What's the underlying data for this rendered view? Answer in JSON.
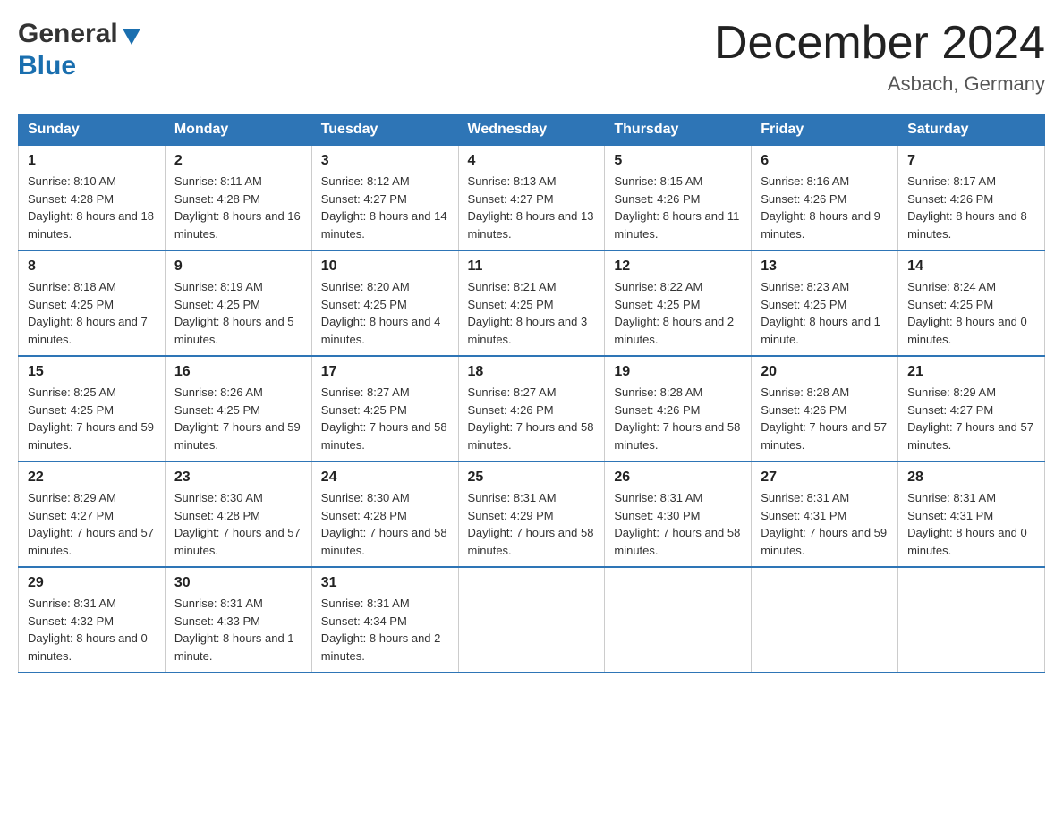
{
  "header": {
    "logo_general": "General",
    "logo_blue": "Blue",
    "calendar_title": "December 2024",
    "calendar_subtitle": "Asbach, Germany"
  },
  "columns": [
    "Sunday",
    "Monday",
    "Tuesday",
    "Wednesday",
    "Thursday",
    "Friday",
    "Saturday"
  ],
  "weeks": [
    [
      {
        "day": "1",
        "sunrise": "8:10 AM",
        "sunset": "4:28 PM",
        "daylight": "8 hours and 18 minutes."
      },
      {
        "day": "2",
        "sunrise": "8:11 AM",
        "sunset": "4:28 PM",
        "daylight": "8 hours and 16 minutes."
      },
      {
        "day": "3",
        "sunrise": "8:12 AM",
        "sunset": "4:27 PM",
        "daylight": "8 hours and 14 minutes."
      },
      {
        "day": "4",
        "sunrise": "8:13 AM",
        "sunset": "4:27 PM",
        "daylight": "8 hours and 13 minutes."
      },
      {
        "day": "5",
        "sunrise": "8:15 AM",
        "sunset": "4:26 PM",
        "daylight": "8 hours and 11 minutes."
      },
      {
        "day": "6",
        "sunrise": "8:16 AM",
        "sunset": "4:26 PM",
        "daylight": "8 hours and 9 minutes."
      },
      {
        "day": "7",
        "sunrise": "8:17 AM",
        "sunset": "4:26 PM",
        "daylight": "8 hours and 8 minutes."
      }
    ],
    [
      {
        "day": "8",
        "sunrise": "8:18 AM",
        "sunset": "4:25 PM",
        "daylight": "8 hours and 7 minutes."
      },
      {
        "day": "9",
        "sunrise": "8:19 AM",
        "sunset": "4:25 PM",
        "daylight": "8 hours and 5 minutes."
      },
      {
        "day": "10",
        "sunrise": "8:20 AM",
        "sunset": "4:25 PM",
        "daylight": "8 hours and 4 minutes."
      },
      {
        "day": "11",
        "sunrise": "8:21 AM",
        "sunset": "4:25 PM",
        "daylight": "8 hours and 3 minutes."
      },
      {
        "day": "12",
        "sunrise": "8:22 AM",
        "sunset": "4:25 PM",
        "daylight": "8 hours and 2 minutes."
      },
      {
        "day": "13",
        "sunrise": "8:23 AM",
        "sunset": "4:25 PM",
        "daylight": "8 hours and 1 minute."
      },
      {
        "day": "14",
        "sunrise": "8:24 AM",
        "sunset": "4:25 PM",
        "daylight": "8 hours and 0 minutes."
      }
    ],
    [
      {
        "day": "15",
        "sunrise": "8:25 AM",
        "sunset": "4:25 PM",
        "daylight": "7 hours and 59 minutes."
      },
      {
        "day": "16",
        "sunrise": "8:26 AM",
        "sunset": "4:25 PM",
        "daylight": "7 hours and 59 minutes."
      },
      {
        "day": "17",
        "sunrise": "8:27 AM",
        "sunset": "4:25 PM",
        "daylight": "7 hours and 58 minutes."
      },
      {
        "day": "18",
        "sunrise": "8:27 AM",
        "sunset": "4:26 PM",
        "daylight": "7 hours and 58 minutes."
      },
      {
        "day": "19",
        "sunrise": "8:28 AM",
        "sunset": "4:26 PM",
        "daylight": "7 hours and 58 minutes."
      },
      {
        "day": "20",
        "sunrise": "8:28 AM",
        "sunset": "4:26 PM",
        "daylight": "7 hours and 57 minutes."
      },
      {
        "day": "21",
        "sunrise": "8:29 AM",
        "sunset": "4:27 PM",
        "daylight": "7 hours and 57 minutes."
      }
    ],
    [
      {
        "day": "22",
        "sunrise": "8:29 AM",
        "sunset": "4:27 PM",
        "daylight": "7 hours and 57 minutes."
      },
      {
        "day": "23",
        "sunrise": "8:30 AM",
        "sunset": "4:28 PM",
        "daylight": "7 hours and 57 minutes."
      },
      {
        "day": "24",
        "sunrise": "8:30 AM",
        "sunset": "4:28 PM",
        "daylight": "7 hours and 58 minutes."
      },
      {
        "day": "25",
        "sunrise": "8:31 AM",
        "sunset": "4:29 PM",
        "daylight": "7 hours and 58 minutes."
      },
      {
        "day": "26",
        "sunrise": "8:31 AM",
        "sunset": "4:30 PM",
        "daylight": "7 hours and 58 minutes."
      },
      {
        "day": "27",
        "sunrise": "8:31 AM",
        "sunset": "4:31 PM",
        "daylight": "7 hours and 59 minutes."
      },
      {
        "day": "28",
        "sunrise": "8:31 AM",
        "sunset": "4:31 PM",
        "daylight": "8 hours and 0 minutes."
      }
    ],
    [
      {
        "day": "29",
        "sunrise": "8:31 AM",
        "sunset": "4:32 PM",
        "daylight": "8 hours and 0 minutes."
      },
      {
        "day": "30",
        "sunrise": "8:31 AM",
        "sunset": "4:33 PM",
        "daylight": "8 hours and 1 minute."
      },
      {
        "day": "31",
        "sunrise": "8:31 AM",
        "sunset": "4:34 PM",
        "daylight": "8 hours and 2 minutes."
      },
      null,
      null,
      null,
      null
    ]
  ],
  "labels": {
    "sunrise": "Sunrise:",
    "sunset": "Sunset:",
    "daylight": "Daylight:"
  }
}
